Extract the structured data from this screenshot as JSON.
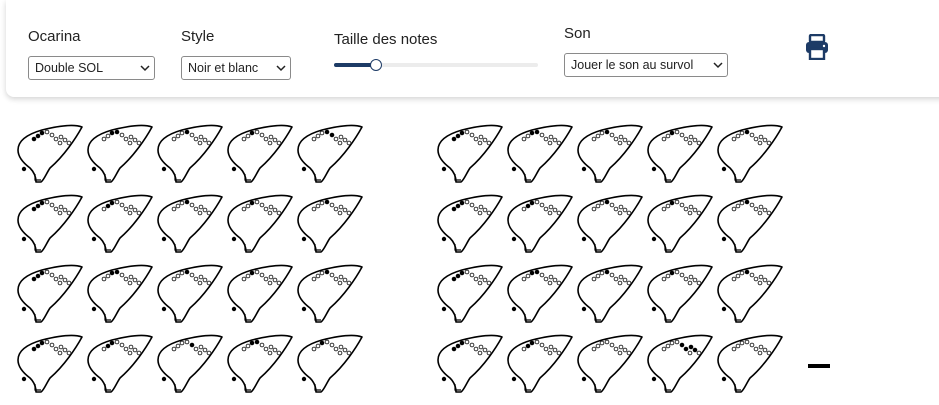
{
  "toolbar": {
    "ocarina": {
      "label": "Ocarina",
      "value": "Double SOL"
    },
    "style": {
      "label": "Style",
      "value": "Noir et blanc"
    },
    "size": {
      "label": "Taille des notes",
      "level_percent": 20
    },
    "sound": {
      "label": "Son",
      "value": "Jouer le son au survol"
    },
    "print_icon": "printer-icon"
  },
  "colors": {
    "accent": "#1d3b66",
    "ink": "#000000"
  },
  "grid": {
    "left_group": [
      [
        [
          "f",
          "f",
          "f",
          "e",
          "e",
          "e",
          "e",
          "e",
          "e",
          "e"
        ],
        [
          "e",
          "e",
          "f",
          "f",
          "e",
          "e",
          "e",
          "e",
          "e",
          "e"
        ],
        [
          "e",
          "e",
          "e",
          "f",
          "e",
          "e",
          "e",
          "e",
          "e",
          "e"
        ],
        [
          "e",
          "e",
          "f",
          "e",
          "e",
          "e",
          "e",
          "e",
          "e",
          "e"
        ],
        [
          "e",
          "e",
          "e",
          "f",
          "f",
          "e",
          "e",
          "e",
          "e",
          "e"
        ]
      ],
      [
        [
          "f",
          "f",
          "f",
          "e",
          "e",
          "e",
          "e",
          "e",
          "e",
          "e"
        ],
        [
          "e",
          "f",
          "f",
          "e",
          "e",
          "e",
          "e",
          "e",
          "e",
          "e"
        ],
        [
          "e",
          "e",
          "e",
          "f",
          "e",
          "e",
          "e",
          "e",
          "e",
          "e"
        ],
        [
          "e",
          "e",
          "f",
          "e",
          "e",
          "e",
          "e",
          "e",
          "e",
          "e"
        ],
        [
          "e",
          "e",
          "e",
          "f",
          "e",
          "e",
          "e",
          "e",
          "e",
          "e"
        ]
      ],
      [
        [
          "f",
          "f",
          "f",
          "e",
          "e",
          "e",
          "e",
          "e",
          "e",
          "e"
        ],
        [
          "e",
          "e",
          "f",
          "f",
          "e",
          "e",
          "e",
          "e",
          "e",
          "e"
        ],
        [
          "e",
          "e",
          "e",
          "f",
          "e",
          "e",
          "e",
          "e",
          "e",
          "e"
        ],
        [
          "e",
          "e",
          "f",
          "e",
          "e",
          "e",
          "e",
          "e",
          "e",
          "e"
        ],
        [
          "e",
          "e",
          "e",
          "f",
          "e",
          "e",
          "e",
          "e",
          "e",
          "e"
        ]
      ],
      [
        [
          "f",
          "f",
          "f",
          "e",
          "e",
          "e",
          "e",
          "e",
          "e",
          "e"
        ],
        [
          "e",
          "f",
          "f",
          "e",
          "e",
          "e",
          "e",
          "e",
          "e",
          "e"
        ],
        [
          "e",
          "e",
          "e",
          "e",
          "f",
          "e",
          "e",
          "e",
          "e",
          "e"
        ],
        [
          "e",
          "e",
          "f",
          "f",
          "e",
          "e",
          "e",
          "e",
          "e",
          "e"
        ],
        [
          "e",
          "e",
          "f",
          "e",
          "e",
          "e",
          "e",
          "e",
          "e",
          "e"
        ]
      ]
    ],
    "right_group": [
      [
        [
          "f",
          "f",
          "f",
          "e",
          "e",
          "e",
          "e",
          "e",
          "e",
          "e"
        ],
        [
          "e",
          "e",
          "f",
          "f",
          "e",
          "e",
          "e",
          "e",
          "e",
          "e"
        ],
        [
          "e",
          "e",
          "e",
          "f",
          "e",
          "e",
          "e",
          "e",
          "e",
          "e"
        ],
        [
          "e",
          "e",
          "f",
          "e",
          "e",
          "e",
          "e",
          "e",
          "e",
          "e"
        ],
        [
          "e",
          "e",
          "e",
          "f",
          "e",
          "e",
          "e",
          "e",
          "e",
          "e"
        ]
      ],
      [
        [
          "f",
          "f",
          "f",
          "e",
          "e",
          "e",
          "e",
          "e",
          "e",
          "e"
        ],
        [
          "e",
          "f",
          "f",
          "e",
          "e",
          "e",
          "e",
          "e",
          "e",
          "e"
        ],
        [
          "e",
          "e",
          "e",
          "f",
          "e",
          "e",
          "e",
          "e",
          "e",
          "e"
        ],
        [
          "e",
          "e",
          "f",
          "e",
          "e",
          "e",
          "e",
          "e",
          "e",
          "e"
        ],
        [
          "e",
          "e",
          "e",
          "f",
          "e",
          "e",
          "e",
          "e",
          "e",
          "e"
        ]
      ],
      [
        [
          "f",
          "f",
          "f",
          "e",
          "e",
          "e",
          "e",
          "e",
          "e",
          "e"
        ],
        [
          "e",
          "e",
          "f",
          "f",
          "e",
          "e",
          "e",
          "e",
          "e",
          "e"
        ],
        [
          "e",
          "e",
          "e",
          "f",
          "e",
          "e",
          "e",
          "e",
          "e",
          "e"
        ],
        [
          "e",
          "e",
          "f",
          "e",
          "e",
          "e",
          "e",
          "e",
          "e",
          "e"
        ],
        [
          "e",
          "e",
          "e",
          "f",
          "e",
          "e",
          "e",
          "e",
          "e",
          "e"
        ]
      ],
      [
        [
          "f",
          "f",
          "f",
          "e",
          "e",
          "e",
          "e",
          "e",
          "e",
          "e"
        ],
        [
          "e",
          "f",
          "f",
          "e",
          "e",
          "e",
          "e",
          "e",
          "e",
          "e"
        ],
        [
          "e",
          "e",
          "e",
          "e",
          "e",
          "e",
          "e",
          "e",
          "e",
          "e"
        ],
        [
          "e",
          "e",
          "e",
          "e",
          "f",
          "f",
          "f",
          "f",
          "e",
          "e"
        ],
        [
          "e",
          "e",
          "e",
          "e",
          "e",
          "e",
          "e",
          "e",
          "e",
          "e"
        ]
      ]
    ],
    "trailing_symbol": "rest-dash"
  }
}
